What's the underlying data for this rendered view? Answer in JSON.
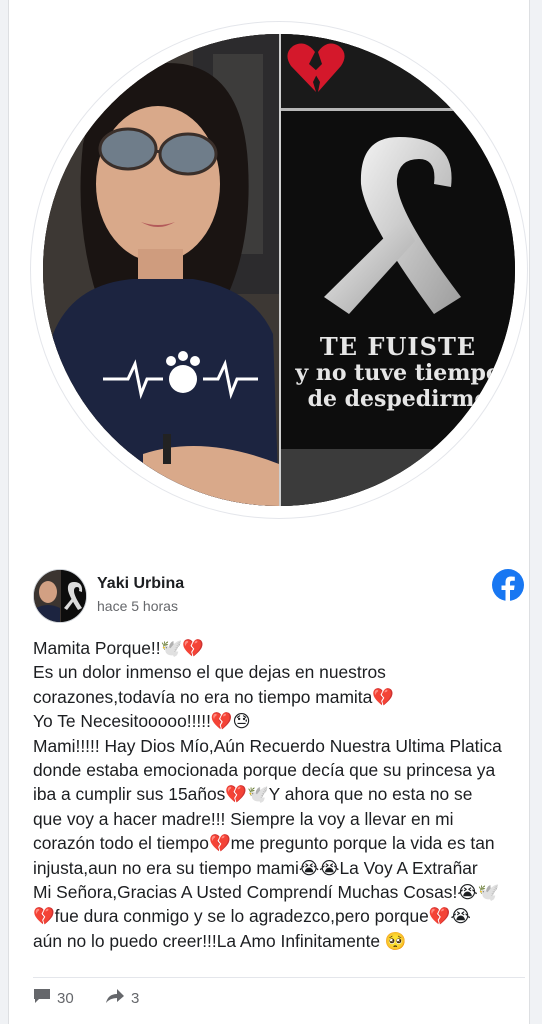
{
  "profile_image": {
    "photo_text": [
      "TE FUISTE",
      "y no tuve tiempo",
      "de despedirme"
    ]
  },
  "post": {
    "author": "Yaki Urbina",
    "timestamp": "hace 5 horas",
    "lines": [
      "Mamita Porque!!🕊️💔",
      "Es un dolor inmenso el que dejas en nuestros",
      "corazones,todavía no era no tiempo mamita💔",
      "Yo Te Necesitooooo!!!!!💔😓",
      "Mami!!!!! Hay Dios Mío,Aún Recuerdo Nuestra Ultima Platica",
      "donde estaba emocionada porque decía que su princesa ya",
      "iba a cumplir sus 15años💔🕊️Y ahora que no esta no se",
      "que voy a hacer madre!!! Siempre la voy a llevar en mi",
      "corazón todo el tiempo💔me pregunto porque la vida es tan",
      "injusta,aun no era su tiempo mami😭😭La Voy A Extrañar",
      "Mi Señora,Gracias A Usted Comprendí Muchas Cosas!😭🕊️",
      "💔fue dura conmigo y se lo agradezco,pero porque💔😭",
      "aún no lo puedo creer!!!La Amo Infinitamente 🥺"
    ]
  },
  "footer": {
    "comments_count": "30",
    "shares_count": "3",
    "comment_icon": "comment-icon",
    "share_icon": "share-icon"
  },
  "colors": {
    "facebook_blue": "#1877f2",
    "text_primary": "#1c1e21",
    "text_secondary": "#65676b"
  }
}
